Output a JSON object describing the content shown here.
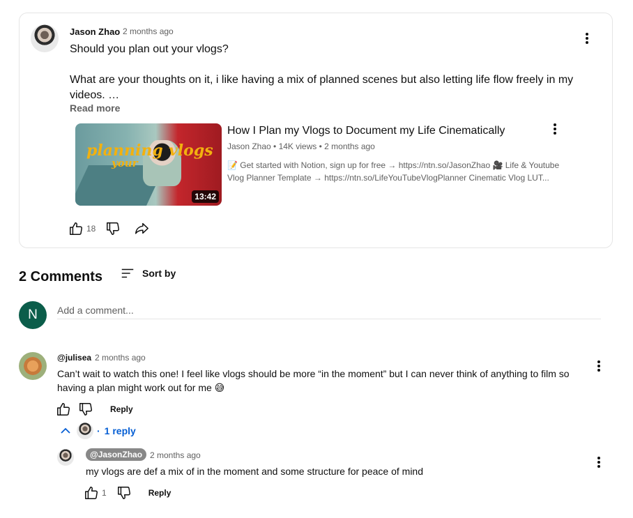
{
  "post": {
    "author": "Jason Zhao",
    "time": "2 months ago",
    "text": "Should you plan out your vlogs?\n\nWhat are your thoughts on it, i like having a mix of planned scenes but also letting life flow freely in my videos. …",
    "read_more": "Read more",
    "likes": "18",
    "video": {
      "title": "How I Plan my Vlogs to Document my Life Cinematically",
      "meta": "Jason Zhao • 14K views • 2 months ago",
      "description": "📝 Get started with Notion, sign up for free → https://ntn.so/JasonZhao 🎥 Life & Youtube Vlog Planner Template → https://ntn.so/LifeYouTubeVlogPlanner Cinematic Vlog LUT...",
      "duration": "13:42",
      "thumb_words": [
        "planning",
        "your",
        "vlogs"
      ]
    }
  },
  "comments_section": {
    "header": "2 Comments",
    "sort_label": "Sort by",
    "user_initial": "N",
    "add_placeholder": "Add a comment..."
  },
  "comments": [
    {
      "author": "@julisea",
      "time": "2 months ago",
      "text": "Can’t wait to watch this one! I feel like vlogs should be more “in the moment” but I can never think of anything to film so having a plan might work out for me 😅",
      "reply_label": "Reply",
      "replies_toggle": "1 reply",
      "replies": [
        {
          "author": "@JasonZhao",
          "time": "2 months ago",
          "text": "my vlogs are def a mix of in the moment and some structure for peace of mind",
          "likes": "1",
          "reply_label": "Reply"
        }
      ]
    }
  ],
  "colors": {
    "link_blue": "#065fd4",
    "user_avatar": "#0b5d4a",
    "muted": "#606060"
  },
  "icons": [
    "three-dots-vertical-icon",
    "thumbs-up-icon",
    "thumbs-down-icon",
    "share-icon",
    "sort-icon",
    "chevron-up-icon"
  ]
}
